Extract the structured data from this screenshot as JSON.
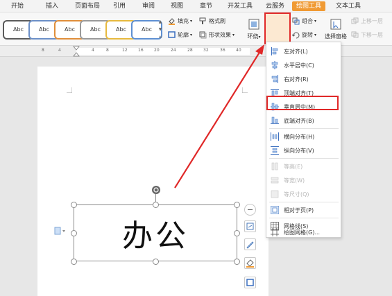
{
  "tabs": [
    "开始",
    "插入",
    "页面布局",
    "引用",
    "审阅",
    "视图",
    "章节",
    "开发工具",
    "云服务",
    "绘图工具",
    "文本工具"
  ],
  "active_tab_index": 9,
  "ribbon": {
    "styles": [
      "Abc",
      "Abc",
      "Abc",
      "Abc",
      "Abc",
      "Abc"
    ],
    "style_border_colors": [
      "#5a5a5a",
      "#6b8fc7",
      "#e08e3a",
      "#9a9a9a",
      "#e7b93e",
      "#5d8fd2"
    ],
    "fill": "填充",
    "format_painter": "格式刷",
    "outline": "轮廓",
    "shape_effects": "形状效果",
    "wrap": "环绕",
    "align": "对齐",
    "group": "组合",
    "rotate": "旋转",
    "selection_pane": "选择窗格",
    "bring_forward": "上移一层",
    "send_backward": "下移一层"
  },
  "ruler_ticks": [
    "8",
    "4",
    "4",
    "8",
    "12",
    "16",
    "20",
    "24",
    "28",
    "32",
    "36",
    "40"
  ],
  "shape_text": "办公",
  "menu": {
    "items": [
      {
        "label": "左对齐(L)",
        "icon": "align-left-icon",
        "enabled": true
      },
      {
        "label": "水平居中(C)",
        "icon": "align-center-icon",
        "enabled": true
      },
      {
        "label": "右对齐(R)",
        "icon": "align-right-icon",
        "enabled": true
      },
      {
        "label": "顶端对齐(T)",
        "icon": "align-top-icon",
        "enabled": true
      },
      {
        "label": "垂直居中(M)",
        "icon": "align-middle-icon",
        "enabled": true
      },
      {
        "label": "底端对齐(B)",
        "icon": "align-bottom-icon",
        "enabled": true
      },
      {
        "label": "横向分布(H)",
        "icon": "distribute-horizontal-icon",
        "enabled": true
      },
      {
        "label": "纵向分布(V)",
        "icon": "distribute-vertical-icon",
        "enabled": true
      },
      {
        "label": "等高(E)",
        "icon": "same-height-icon",
        "enabled": false
      },
      {
        "label": "等宽(W)",
        "icon": "same-width-icon",
        "enabled": false
      },
      {
        "label": "等尺寸(Q)",
        "icon": "same-size-icon",
        "enabled": false
      },
      {
        "label": "相对于页(P)",
        "icon": "relative-to-page-icon",
        "enabled": true
      },
      {
        "label": "网格线(S)",
        "icon": "gridlines-icon",
        "enabled": true
      },
      {
        "label": "绘图网格(G)...",
        "icon": "drawing-grid-icon",
        "enabled": true
      }
    ],
    "highlighted_index": 4
  },
  "colors": {
    "accent": "#f09a33",
    "highlight": "#e02828"
  }
}
